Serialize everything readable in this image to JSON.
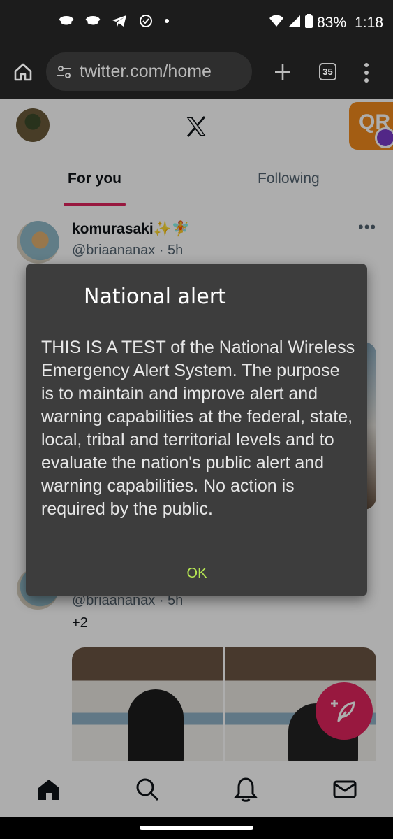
{
  "status_bar": {
    "battery": "83%",
    "time": "1:18"
  },
  "browser": {
    "url": "twitter.com/home",
    "tab_count": "35"
  },
  "header": {
    "logo": "X",
    "qr_badge": "QR"
  },
  "tabs": [
    {
      "label": "For you"
    },
    {
      "label": "Following"
    }
  ],
  "tweets": [
    {
      "name": "komurasaki✨🧚",
      "handle": "@briaananax · 5h"
    },
    {
      "handle": "@briaananax · 5h",
      "text": "+2"
    }
  ],
  "alert": {
    "title": "National alert",
    "body": "THIS IS A TEST of the National Wireless Emergency Alert System. The purpose is to maintain and improve alert and warning capabilities at the federal, state, local, tribal and territorial levels and to evaluate the nation's public alert and warning capabilities. No action is required by the public.",
    "ok_label": "OK"
  },
  "colors": {
    "accent": "#e0245e",
    "dialog_bg": "#3d3d3d",
    "ok_text": "#b5e553",
    "qr_badge": "#f08a1c"
  }
}
